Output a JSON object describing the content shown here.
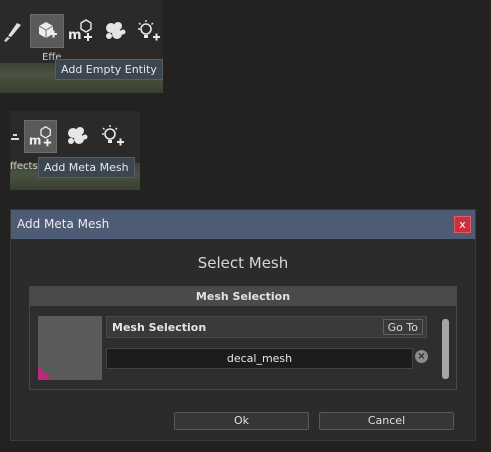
{
  "toolbar_top": {
    "caption": "Effe",
    "tooltip": "Add Empty Entity",
    "icons": [
      "brush-icon",
      "add-empty-entity-icon",
      "add-meta-mesh-icon",
      "particle-effect-icon",
      "add-light-icon"
    ]
  },
  "toolbar_mid": {
    "caption": "ffects",
    "tooltip": "Add Meta Mesh",
    "icons": [
      "add-meta-mesh-icon",
      "particle-effect-icon",
      "add-light-icon"
    ]
  },
  "dialog": {
    "title": "Add Meta Mesh",
    "close_label": "x",
    "heading": "Select Mesh",
    "panel_title": "Mesh Selection",
    "property_label": "Mesh Selection",
    "goto_label": "Go To",
    "mesh_value": "decal_mesh",
    "clear_label": "×",
    "ok_label": "Ok",
    "cancel_label": "Cancel"
  },
  "colors": {
    "titlebar": "#4d5b74",
    "close": "#c8323c",
    "tooltip": "#3c4650",
    "thumb_corner": "#c0277e"
  }
}
